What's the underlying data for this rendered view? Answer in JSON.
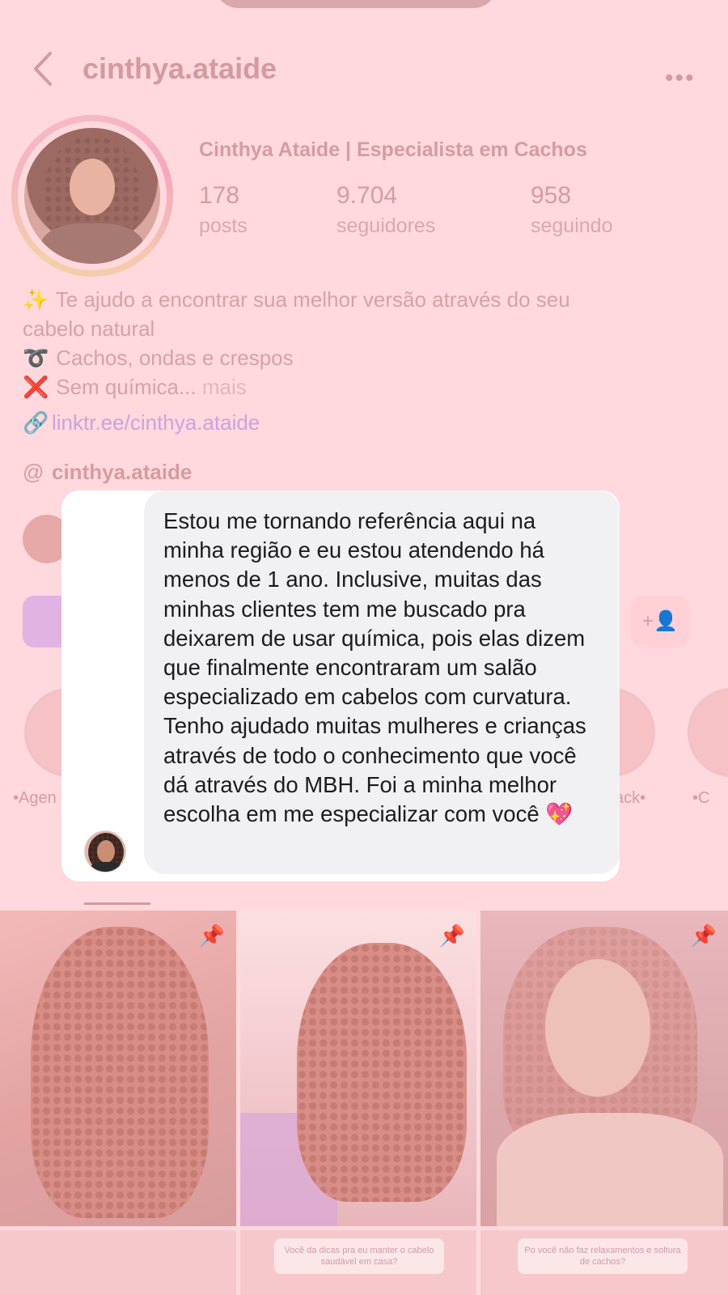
{
  "profile": {
    "username": "cinthya.ataide",
    "full_name": "Cinthya Ataide | Especialista em Cachos",
    "stats": [
      {
        "value": "178",
        "label": "posts"
      },
      {
        "value": "9.704",
        "label": "seguidores"
      },
      {
        "value": "958",
        "label": "seguindo"
      }
    ],
    "bio": {
      "line1_emoji": "✨",
      "line1": "Te ajudo a encontrar sua melhor versão através do seu",
      "line2": "cabelo natural",
      "line3_emoji": "➰",
      "line3": "Cachos, ondas e crespos",
      "line4_emoji": "❌",
      "line4": "Sem química...",
      "more": "mais"
    },
    "link": "linktr.ee/cinthya.ataide",
    "threads_handle": "cinthya.ataide",
    "highlights": [
      {
        "label": "•Agen"
      },
      {
        "label": "ack•"
      },
      {
        "label": "•C"
      }
    ]
  },
  "posts_row2_captions": [
    "Você da dicas pra eu manter o cabelo saudável em casa?",
    "Po você não faz relaxamentos e soltura de cachos?"
  ],
  "testimonial": {
    "message": "Estou me tornando referência aqui na minha região e eu estou atendendo há menos de 1 ano. Inclusive, muitas das minhas clientes tem me buscado pra deixarem de usar química, pois elas dizem que finalmente encontraram um salão especializado em cabelos com curvatura. Tenho ajudado muitas mulheres e crianças através de todo o conhecimento que você dá através do MBH. Foi a minha melhor escolha em me especializar com você 💖"
  },
  "colors": {
    "overlay_pink": "#ffd9dd",
    "bubble_bg": "#f1f1f3",
    "text_dark": "#1c1c1e"
  },
  "icons": [
    "chevron-left-icon",
    "more-horizontal-icon",
    "sparkles-icon",
    "curly-loop-icon",
    "cross-mark-icon",
    "link-icon",
    "threads-icon",
    "add-user-icon",
    "pin-icon"
  ]
}
